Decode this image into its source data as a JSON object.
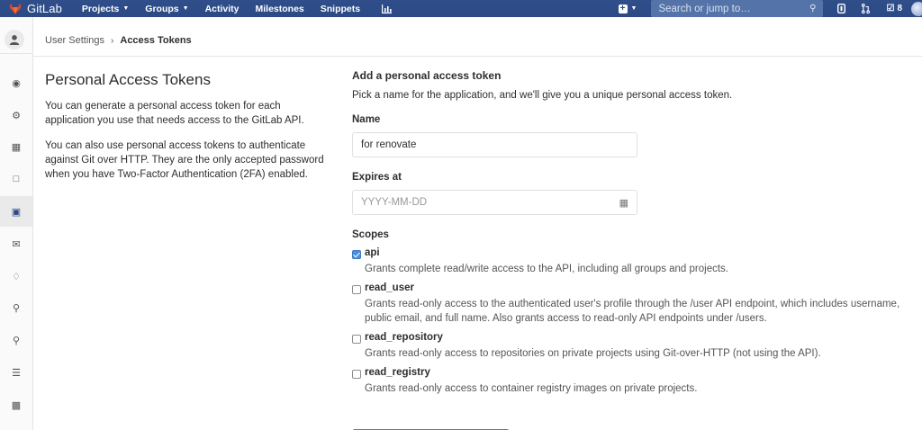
{
  "app": {
    "logo_text": "GitLab"
  },
  "topnav": {
    "items": [
      {
        "label": "Projects",
        "dropdown": true
      },
      {
        "label": "Groups",
        "dropdown": true
      },
      {
        "label": "Activity",
        "dropdown": false
      },
      {
        "label": "Milestones",
        "dropdown": false
      },
      {
        "label": "Snippets",
        "dropdown": false
      }
    ],
    "search_placeholder": "Search or jump to…",
    "todo_count": "8"
  },
  "breadcrumb": {
    "parent": "User Settings",
    "current": "Access Tokens"
  },
  "left": {
    "title": "Personal Access Tokens",
    "desc1": "You can generate a personal access token for each application you use that needs access to the GitLab API.",
    "desc2": "You can also use personal access tokens to authenticate against Git over HTTP. They are the only accepted password when you have Two-Factor Authentication (2FA) enabled."
  },
  "form": {
    "heading": "Add a personal access token",
    "intro": "Pick a name for the application, and we'll give you a unique personal access token.",
    "name_label": "Name",
    "name_value": "for renovate",
    "expires_label": "Expires at",
    "expires_placeholder": "YYYY-MM-DD",
    "scopes_label": "Scopes",
    "scopes": [
      {
        "name": "api",
        "checked": true,
        "desc": "Grants complete read/write access to the API, including all groups and projects."
      },
      {
        "name": "read_user",
        "checked": false,
        "desc": "Grants read-only access to the authenticated user's profile through the /user API endpoint, which includes username, public email, and full name. Also grants access to read-only API endpoints under /users."
      },
      {
        "name": "read_repository",
        "checked": false,
        "desc": "Grants read-only access to repositories on private projects using Git-over-HTTP (not using the API)."
      },
      {
        "name": "read_registry",
        "checked": false,
        "desc": "Grants read-only access to container registry images on private projects."
      }
    ]
  },
  "colors": {
    "navbar": "#2c4a85",
    "accent": "#1aaa55",
    "checkbox": "#4a90d9"
  }
}
